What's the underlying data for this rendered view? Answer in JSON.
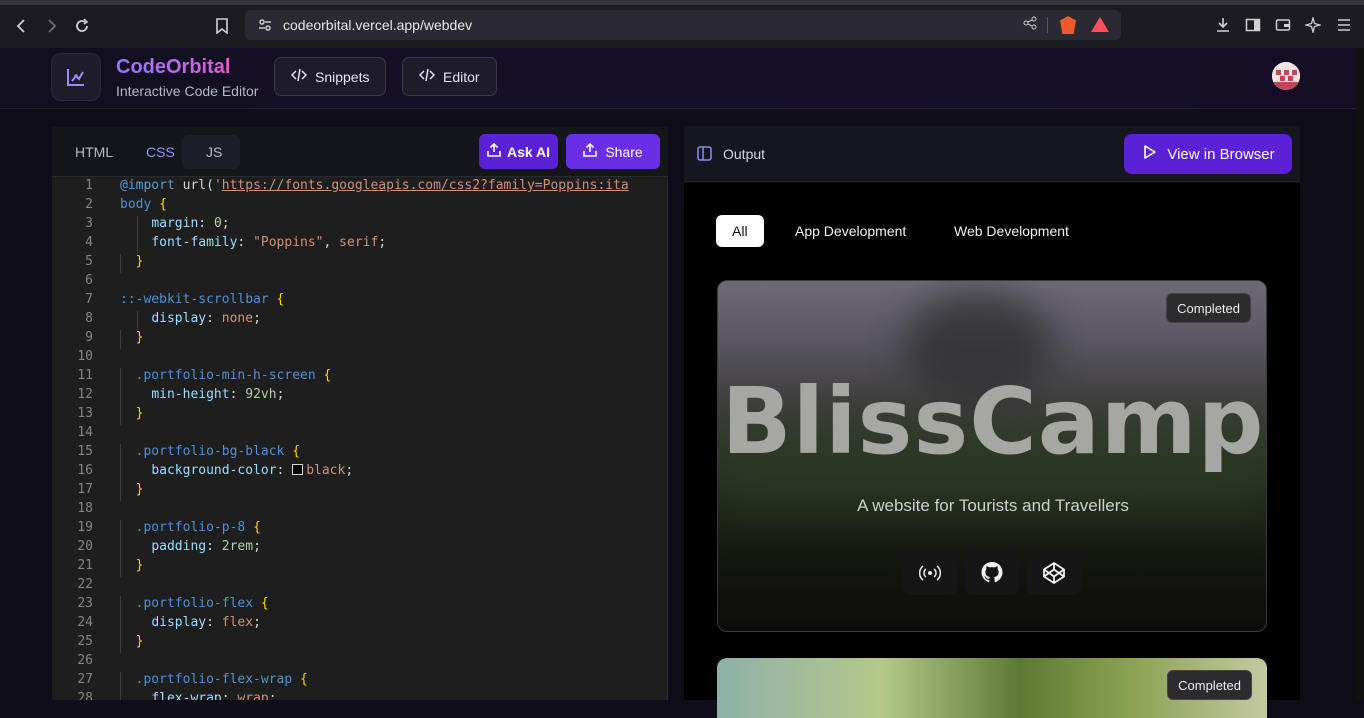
{
  "browser": {
    "url": "codeorbital.vercel.app/webdev"
  },
  "header": {
    "brand": "CodeOrbital",
    "subtitle": "Interactive Code Editor",
    "snippets_label": "Snippets",
    "editor_label": "Editor"
  },
  "editor": {
    "tabs": [
      "HTML",
      "CSS",
      "JS"
    ],
    "active_tab": "CSS",
    "ask_ai_label": "Ask AI",
    "share_label": "Share"
  },
  "code_lines": [
    "@import url('https://fonts.googleapis.com/css2?family=Poppins:ita",
    "body {",
    "    margin: 0;",
    "    font-family: \"Poppins\", serif;",
    "  }",
    "",
    "::-webkit-scrollbar {",
    "    display: none;",
    "  }",
    "",
    "  .portfolio-min-h-screen {",
    "    min-height: 92vh;",
    "  }",
    "",
    "  .portfolio-bg-black {",
    "    background-color: black;",
    "  }",
    "",
    "  .portfolio-p-8 {",
    "    padding: 2rem;",
    "  }",
    "",
    "  .portfolio-flex {",
    "    display: flex;",
    "  }",
    "",
    "  .portfolio-flex-wrap {",
    "    flex-wrap: wrap;"
  ],
  "output": {
    "title": "Output",
    "view_label": "View in Browser",
    "filters": [
      "All",
      "App Development",
      "Web Development"
    ],
    "active_filter": "All",
    "cards": [
      {
        "status": "Completed",
        "title": "BlissCamp",
        "subtitle": "A website for Tourists and Travellers"
      },
      {
        "status": "Completed"
      }
    ]
  },
  "colors": {
    "accent": "#5b21d6",
    "brand_from": "#8b7bff",
    "brand_to": "#e05ad2"
  }
}
